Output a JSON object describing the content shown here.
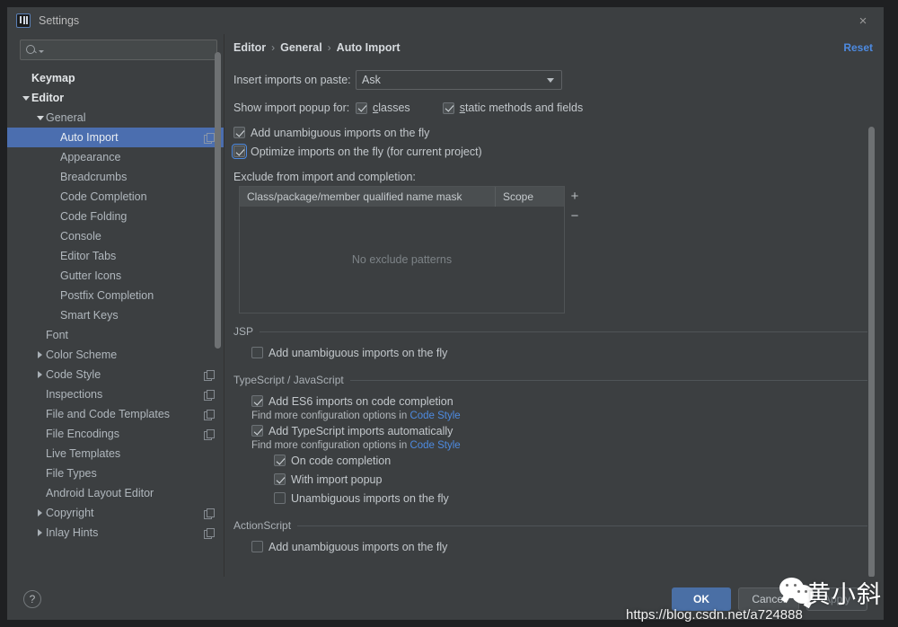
{
  "window": {
    "title": "Settings",
    "close_label": "×",
    "app_icon": "intellij-idea-icon"
  },
  "sidebar": {
    "search": {
      "placeholder": "",
      "value": "",
      "icon": "search-icon"
    },
    "items": [
      {
        "label": "Keymap",
        "indent": 0,
        "arrow": "none",
        "bold": true,
        "badge": false,
        "selected": false
      },
      {
        "label": "Editor",
        "indent": 0,
        "arrow": "expanded",
        "bold": true,
        "badge": false,
        "selected": false
      },
      {
        "label": "General",
        "indent": 1,
        "arrow": "expanded",
        "bold": false,
        "badge": false,
        "selected": false
      },
      {
        "label": "Auto Import",
        "indent": 2,
        "arrow": "none",
        "bold": false,
        "badge": true,
        "selected": true
      },
      {
        "label": "Appearance",
        "indent": 2,
        "arrow": "none",
        "bold": false,
        "badge": false,
        "selected": false
      },
      {
        "label": "Breadcrumbs",
        "indent": 2,
        "arrow": "none",
        "bold": false,
        "badge": false,
        "selected": false
      },
      {
        "label": "Code Completion",
        "indent": 2,
        "arrow": "none",
        "bold": false,
        "badge": false,
        "selected": false
      },
      {
        "label": "Code Folding",
        "indent": 2,
        "arrow": "none",
        "bold": false,
        "badge": false,
        "selected": false
      },
      {
        "label": "Console",
        "indent": 2,
        "arrow": "none",
        "bold": false,
        "badge": false,
        "selected": false
      },
      {
        "label": "Editor Tabs",
        "indent": 2,
        "arrow": "none",
        "bold": false,
        "badge": false,
        "selected": false
      },
      {
        "label": "Gutter Icons",
        "indent": 2,
        "arrow": "none",
        "bold": false,
        "badge": false,
        "selected": false
      },
      {
        "label": "Postfix Completion",
        "indent": 2,
        "arrow": "none",
        "bold": false,
        "badge": false,
        "selected": false
      },
      {
        "label": "Smart Keys",
        "indent": 2,
        "arrow": "none",
        "bold": false,
        "badge": false,
        "selected": false
      },
      {
        "label": "Font",
        "indent": 1,
        "arrow": "none",
        "bold": false,
        "badge": false,
        "selected": false
      },
      {
        "label": "Color Scheme",
        "indent": 1,
        "arrow": "collapsed",
        "bold": false,
        "badge": false,
        "selected": false
      },
      {
        "label": "Code Style",
        "indent": 1,
        "arrow": "collapsed",
        "bold": false,
        "badge": true,
        "selected": false
      },
      {
        "label": "Inspections",
        "indent": 1,
        "arrow": "none",
        "bold": false,
        "badge": true,
        "selected": false
      },
      {
        "label": "File and Code Templates",
        "indent": 1,
        "arrow": "none",
        "bold": false,
        "badge": true,
        "selected": false
      },
      {
        "label": "File Encodings",
        "indent": 1,
        "arrow": "none",
        "bold": false,
        "badge": true,
        "selected": false
      },
      {
        "label": "Live Templates",
        "indent": 1,
        "arrow": "none",
        "bold": false,
        "badge": false,
        "selected": false
      },
      {
        "label": "File Types",
        "indent": 1,
        "arrow": "none",
        "bold": false,
        "badge": false,
        "selected": false
      },
      {
        "label": "Android Layout Editor",
        "indent": 1,
        "arrow": "none",
        "bold": false,
        "badge": false,
        "selected": false
      },
      {
        "label": "Copyright",
        "indent": 1,
        "arrow": "collapsed",
        "bold": false,
        "badge": true,
        "selected": false
      },
      {
        "label": "Inlay Hints",
        "indent": 1,
        "arrow": "collapsed",
        "bold": false,
        "badge": true,
        "selected": false
      }
    ]
  },
  "content": {
    "breadcrumb": [
      "Editor",
      "General",
      "Auto Import"
    ],
    "breadcrumb_separator": "›",
    "reset_label": "Reset",
    "insert_imports": {
      "label": "Insert imports on paste:",
      "value": "Ask"
    },
    "show_popup": {
      "label": "Show import popup for:",
      "classes": {
        "label": "classes",
        "mnemonic": "c",
        "checked": true
      },
      "static": {
        "label": "static methods and fields",
        "mnemonic": "s",
        "checked": true
      }
    },
    "add_unambiguous": {
      "label": "Add unambiguous imports on the fly",
      "checked": true
    },
    "optimize_imports": {
      "label": "Optimize imports on the fly (for current project)",
      "checked": true,
      "focused": true
    },
    "exclude_label": "Exclude from import and completion:",
    "exclude_table": {
      "columns": [
        "Class/package/member qualified name mask",
        "Scope"
      ],
      "rows": [],
      "empty_text": "No exclude patterns",
      "add_label": "+",
      "remove_label": "−"
    },
    "sections": [
      {
        "title": "JSP",
        "options": [
          {
            "label": "Add unambiguous imports on the fly",
            "checked": false,
            "indent": 1
          }
        ]
      },
      {
        "title": "TypeScript / JavaScript",
        "options": [
          {
            "label": "Add ES6 imports on code completion",
            "checked": true,
            "indent": 1,
            "hint_prefix": "Find more configuration options in ",
            "hint_link": "Code Style"
          },
          {
            "label": "Add TypeScript imports automatically",
            "checked": true,
            "indent": 1,
            "hint_prefix": "Find more configuration options in ",
            "hint_link": "Code Style"
          },
          {
            "label": "On code completion",
            "checked": true,
            "indent": 2
          },
          {
            "label": "With import popup",
            "checked": true,
            "indent": 2
          },
          {
            "label": "Unambiguous imports on the fly",
            "checked": false,
            "indent": 2
          }
        ]
      },
      {
        "title": "ActionScript",
        "options": [
          {
            "label": "Add unambiguous imports on the fly",
            "checked": false,
            "indent": 1
          }
        ]
      }
    ]
  },
  "footer": {
    "help_label": "?",
    "ok_label": "OK",
    "cancel_label": "Cancel",
    "apply_label": "Apply"
  },
  "watermark": {
    "name": "黄小斜",
    "url": "https://blog.csdn.net/a724888",
    "logo": "wechat-logo"
  },
  "colors": {
    "accent": "#4b6eaf",
    "link": "#4d8ae0",
    "primary_button": "#4a6fa5",
    "panel": "#3c3f41"
  }
}
